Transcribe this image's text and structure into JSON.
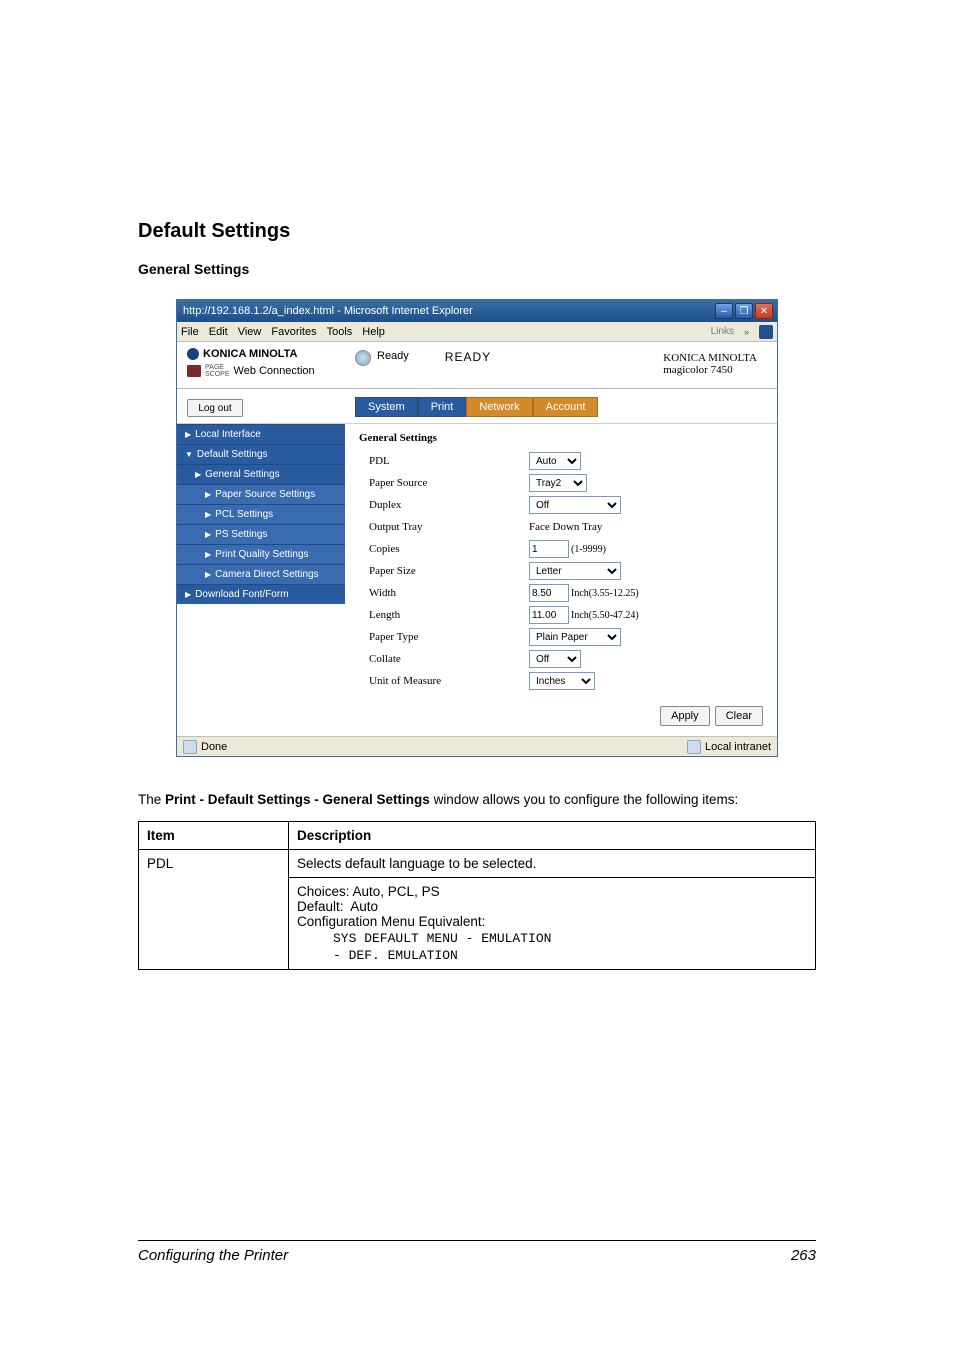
{
  "headings": {
    "section": "Default Settings",
    "sub": "General Settings"
  },
  "screenshot": {
    "window_title": "http://192.168.1.2/a_index.html - Microsoft Internet Explorer",
    "menus": [
      "File",
      "Edit",
      "View",
      "Favorites",
      "Tools",
      "Help"
    ],
    "links_label": "Links",
    "brand1": "KONICA MINOLTA",
    "brand2_small": "PAGE\nSCOPE",
    "brand2": "Web Connection",
    "ready_small": "Ready",
    "ready_big": "READY",
    "header_right1": "KONICA MINOLTA",
    "header_right2": "magicolor 7450",
    "logout": "Log out",
    "tabs": [
      "System",
      "Print",
      "Network",
      "Account"
    ],
    "sidebar": {
      "items": [
        {
          "label": "Local Interface",
          "level": 0,
          "arrow": "▶"
        },
        {
          "label": "Default Settings",
          "level": 0,
          "arrow": "▼"
        },
        {
          "label": "General Settings",
          "level": 1,
          "arrow": "▶"
        },
        {
          "label": "Paper Source Settings",
          "level": 2,
          "arrow": "▶"
        },
        {
          "label": "PCL Settings",
          "level": 2,
          "arrow": "▶"
        },
        {
          "label": "PS Settings",
          "level": 2,
          "arrow": "▶"
        },
        {
          "label": "Print Quality Settings",
          "level": 2,
          "arrow": "▶"
        },
        {
          "label": "Camera Direct Settings",
          "level": 2,
          "arrow": "▶"
        },
        {
          "label": "Download Font/Form",
          "level": 0,
          "arrow": "▶"
        }
      ]
    },
    "form": {
      "title": "General Settings",
      "rows": [
        {
          "label": "PDL",
          "type": "select",
          "value": "Auto",
          "cls": "w1"
        },
        {
          "label": "Paper Source",
          "type": "select",
          "value": "Tray2",
          "cls": "w2"
        },
        {
          "label": "Duplex",
          "type": "select",
          "value": "Off",
          "cls": "w3"
        },
        {
          "label": "Output Tray",
          "type": "static",
          "value": "Face Down Tray"
        },
        {
          "label": "Copies",
          "type": "text",
          "value": "1",
          "hint": "(1-9999)"
        },
        {
          "label": "Paper Size",
          "type": "select",
          "value": "Letter",
          "cls": "w3"
        },
        {
          "label": "Width",
          "type": "text",
          "value": "8.50",
          "hint": "Inch(3.55-12.25)"
        },
        {
          "label": "Length",
          "type": "text",
          "value": "11.00",
          "hint": "Inch(5.50-47.24)"
        },
        {
          "label": "Paper Type",
          "type": "select",
          "value": "Plain Paper",
          "cls": "w3"
        },
        {
          "label": "Collate",
          "type": "select",
          "value": "Off",
          "cls": "w1"
        },
        {
          "label": "Unit of Measure",
          "type": "select",
          "value": "Inches",
          "cls": "w4"
        }
      ],
      "apply": "Apply",
      "clear": "Clear"
    },
    "status_done": "Done",
    "status_zone": "Local intranet"
  },
  "body_text": {
    "prefix": "The ",
    "bold": "Print - Default Settings - General Settings",
    "suffix": " window allows you to configure the following items:"
  },
  "table": {
    "headers": [
      "Item",
      "Description"
    ],
    "row": {
      "item": "PDL",
      "line1": "Selects default language to be selected.",
      "line2": "Choices: Auto, PCL, PS",
      "line3": "Default:  Auto",
      "line4": "Configuration Menu Equivalent:",
      "mono1": "SYS DEFAULT MENU - EMULATION",
      "mono2": "- DEF. EMULATION"
    }
  },
  "footer": {
    "title": "Configuring the Printer",
    "page": "263"
  }
}
